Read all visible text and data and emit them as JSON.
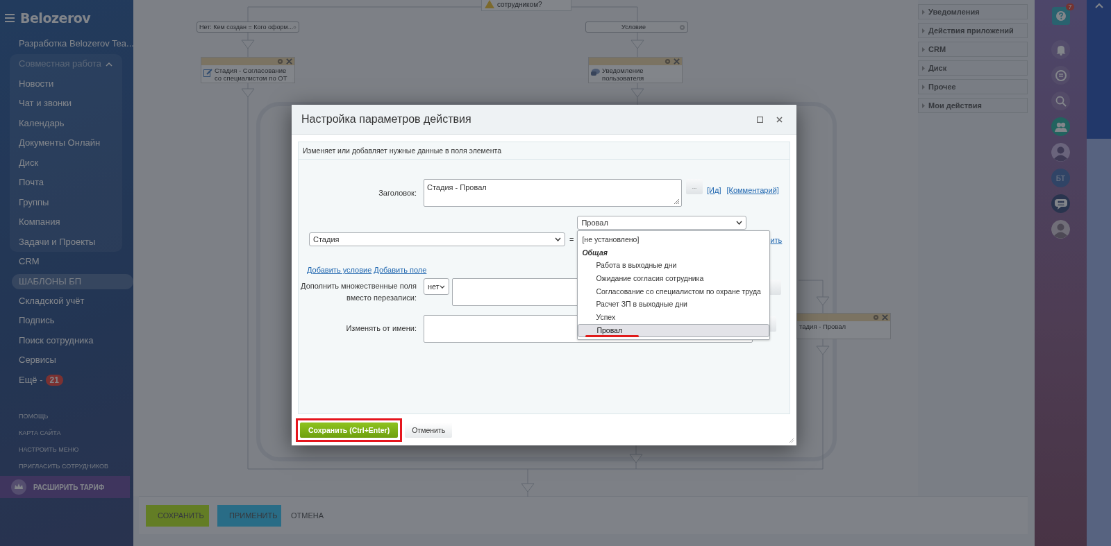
{
  "sidebar": {
    "brand": "Belozerov",
    "workspace": "Разработка Belozerov Tea...",
    "group": {
      "label": "Совместная работа",
      "expanded": true,
      "items": [
        "Новости",
        "Чат и звонки",
        "Календарь",
        "Документы Онлайн",
        "Диск",
        "Почта",
        "Группы",
        "Компания",
        "Задачи и Проекты"
      ]
    },
    "items": [
      {
        "label": "CRM",
        "selected": false
      },
      {
        "label": "ШАБЛОНЫ БП",
        "selected": true
      },
      {
        "label": "Складской учёт",
        "selected": false
      },
      {
        "label": "Подпись",
        "selected": false
      },
      {
        "label": "Поиск сотрудника",
        "selected": false
      },
      {
        "label": "Сервисы",
        "selected": false
      },
      {
        "label": "Ещё -",
        "selected": false,
        "counter": "21"
      }
    ],
    "footer_links": [
      "ПОМОЩЬ",
      "КАРТА САЙТА",
      "НАСТРОИТЬ МЕНЮ",
      "ПРИГЛАСИТЬ СОТРУДНИКОВ"
    ],
    "upgrade": "РАСШИРИТЬ ТАРИФ"
  },
  "canvas": {
    "question": "сотрудником?",
    "conditions": [
      "Нет: Кем создан = Кого оформ...",
      "Условие"
    ],
    "activities": [
      {
        "title": "Стадия - Согласование со специалистом по ОТ",
        "kind": "edit"
      },
      {
        "title": "Уведомление пользователя",
        "kind": "notify"
      },
      {
        "title": "тадия - Провал",
        "kind": "hidden"
      }
    ]
  },
  "activity_panel": {
    "groups": [
      "Уведомления",
      "Действия приложений",
      "CRM",
      "Диск",
      "Прочее",
      "Мои действия"
    ]
  },
  "right_bar": {
    "help_badge": "7",
    "initials": "БТ"
  },
  "bottom_bar": {
    "buttons": [
      {
        "label": "СОХРАНИТЬ",
        "kind": "save"
      },
      {
        "label": "ПРИМЕНИТЬ",
        "kind": "apply"
      },
      {
        "label": "ОТМЕНА",
        "kind": "cancel"
      }
    ]
  },
  "dialog": {
    "title": "Настройка параметров действия",
    "description": "Изменяет или добавляет нужные данные в поля элемента",
    "title_label": "Заголовок:",
    "title_value": "Стадия - Провал",
    "more": "...",
    "title_links": [
      "[Ид]",
      "[Комментарий]"
    ],
    "field_select": "Стадия",
    "equals": "=",
    "value_select": "Провал",
    "options": [
      {
        "label": "[не установлено]",
        "kind": "option",
        "selected": false,
        "underlined": false
      },
      {
        "label": "Общая",
        "kind": "group"
      },
      {
        "label": "Работа в выходные дни",
        "kind": "option",
        "selected": false,
        "underlined": false
      },
      {
        "label": "Ожидание согласия сотрудника",
        "kind": "option",
        "selected": false,
        "underlined": false
      },
      {
        "label": "Согласование со специалистом по охране труда",
        "kind": "option",
        "selected": false,
        "underlined": false
      },
      {
        "label": "Расчет ЗП в выходные дни",
        "kind": "option",
        "selected": false,
        "underlined": false
      },
      {
        "label": "Успех",
        "kind": "option",
        "selected": false,
        "underlined": false
      },
      {
        "label": "Провал",
        "kind": "option",
        "selected": true,
        "underlined": true
      }
    ],
    "row_link_fragment": "ить",
    "add_links": [
      "Добавить условие",
      "Добавить поле"
    ],
    "append_label": "Дополнить множественные поля вместо перезаписи:",
    "append_value": "нет",
    "as_user_label": "Изменять от имени:",
    "save": "Сохранить (Ctrl+Enter)",
    "cancel": "Отменить",
    "save_highlighted": true
  }
}
